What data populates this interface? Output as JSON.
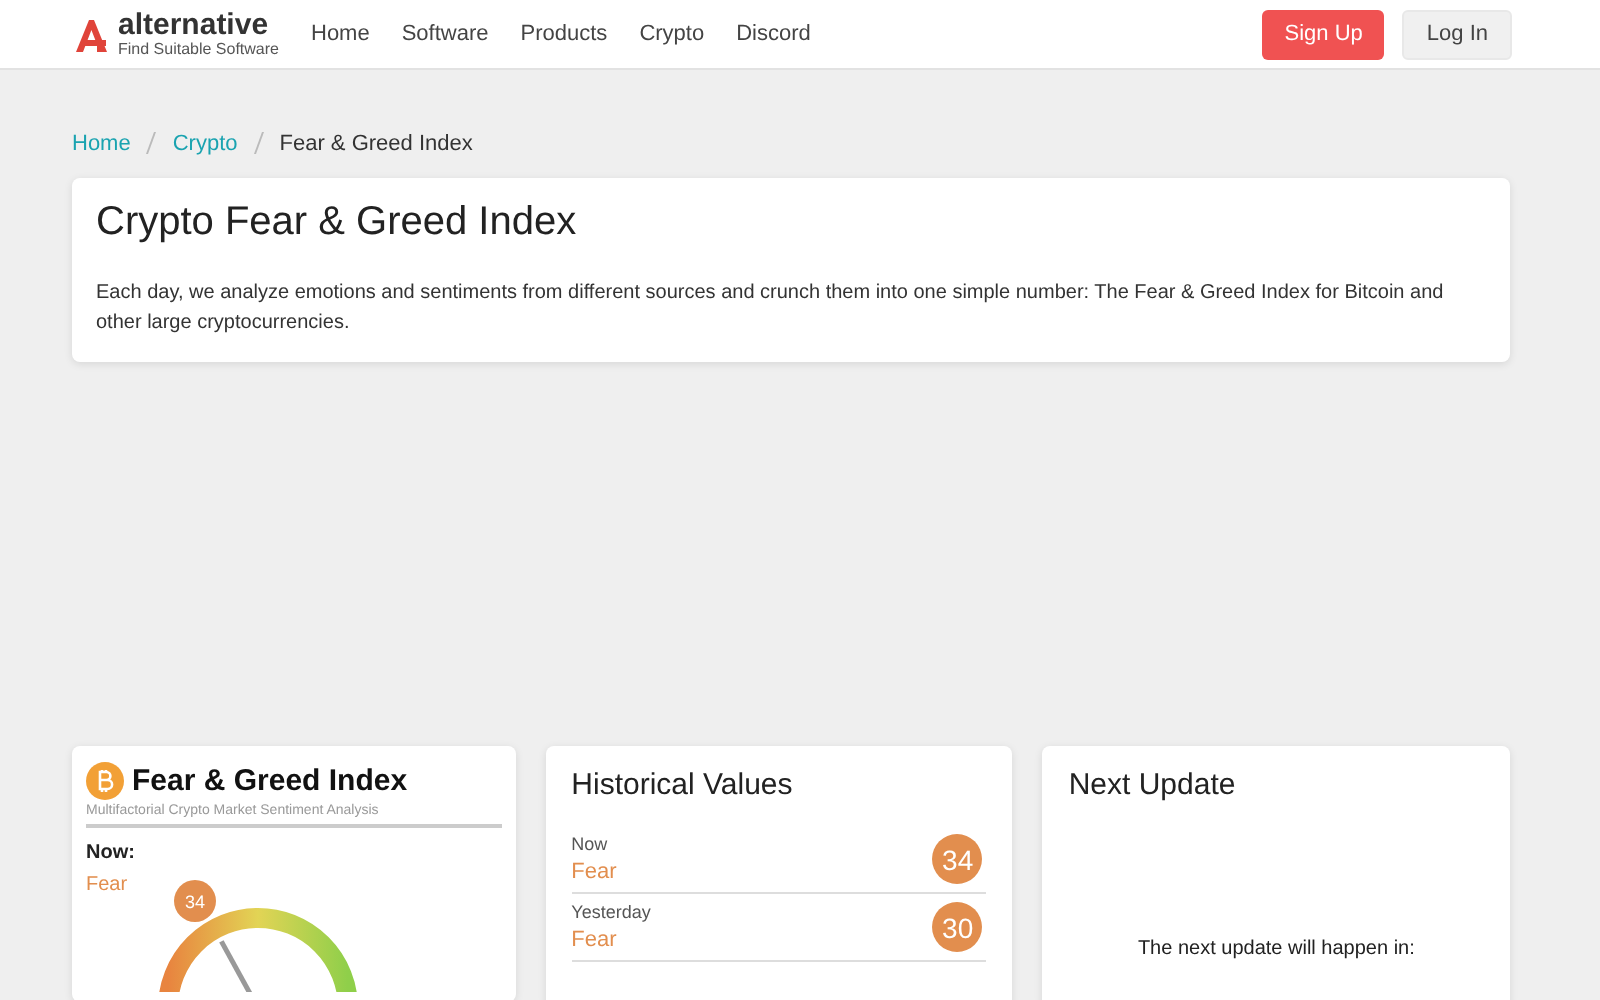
{
  "header": {
    "logo_name": "alternative",
    "logo_tagline": "Find Suitable Software",
    "nav": [
      "Home",
      "Software",
      "Products",
      "Crypto",
      "Discord"
    ],
    "sign_up": "Sign Up",
    "log_in": "Log In"
  },
  "breadcrumb": [
    "Home",
    "Crypto",
    "Fear & Greed Index"
  ],
  "intro": {
    "title": "Crypto Fear & Greed Index",
    "text": "Each day, we analyze emotions and sentiments from different sources and crunch them into one simple number: The Fear & Greed Index for Bitcoin and other large cryptocurrencies."
  },
  "widget": {
    "title": "Fear & Greed Index",
    "subtitle": "Multifactorial Crypto Market Sentiment Analysis",
    "now_label": "Now:",
    "classification": "Fear",
    "value": "34",
    "level": 0.34
  },
  "historical": {
    "title": "Historical Values",
    "rows": [
      {
        "label": "Now",
        "classification": "Fear",
        "value": "34"
      },
      {
        "label": "Yesterday",
        "classification": "Fear",
        "value": "30"
      }
    ]
  },
  "next_update": {
    "title": "Next Update",
    "text": "The next update will happen in:"
  }
}
